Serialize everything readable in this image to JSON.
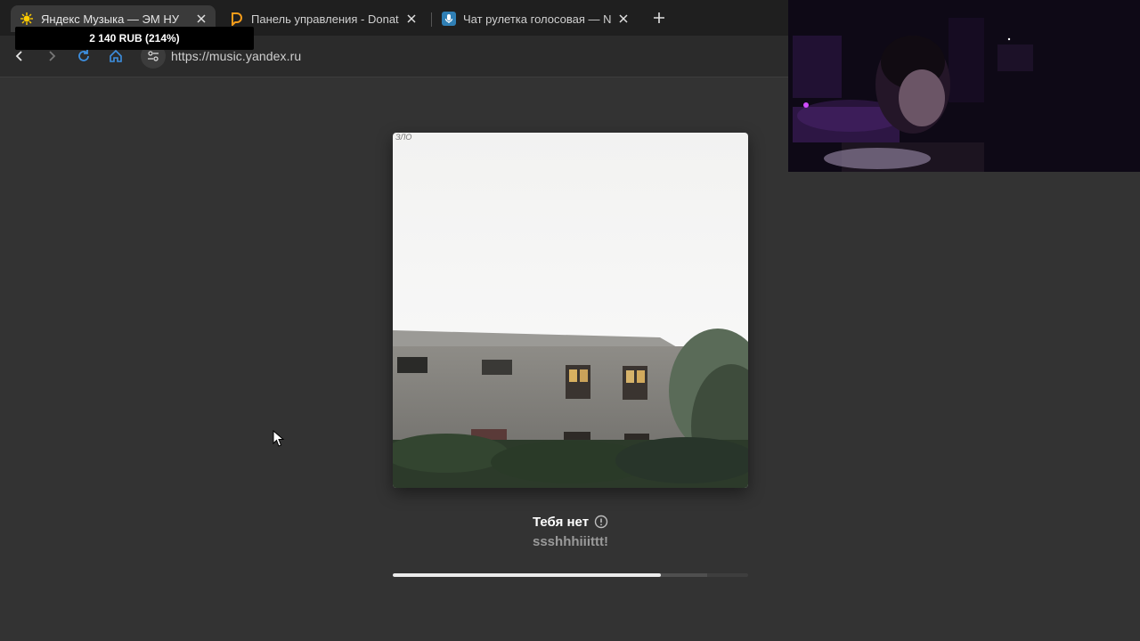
{
  "browser": {
    "tabs": [
      {
        "title": "Яндекс Музыка — ЭМ НУ",
        "favicon": "yandex-music-icon",
        "active": true
      },
      {
        "title": "Панель управления - Donation",
        "favicon": "donationalerts-icon",
        "active": false
      },
      {
        "title": "Чат рулетка голосовая — Nek",
        "favicon": "microphone-icon",
        "active": false
      }
    ],
    "new_tab_label": "+",
    "address": "https://music.yandex.ru"
  },
  "donation_alert": {
    "text": "2 140 RUB (214%)"
  },
  "player": {
    "cover_caption": "ЗЛО",
    "track_title": "Тебя нет",
    "artist": "ssshhhiiittt!",
    "progress_fraction": 0.755,
    "buffered_fraction": 0.885
  },
  "colors": {
    "page_bg": "#333333",
    "progress_fill": "#ececec"
  }
}
